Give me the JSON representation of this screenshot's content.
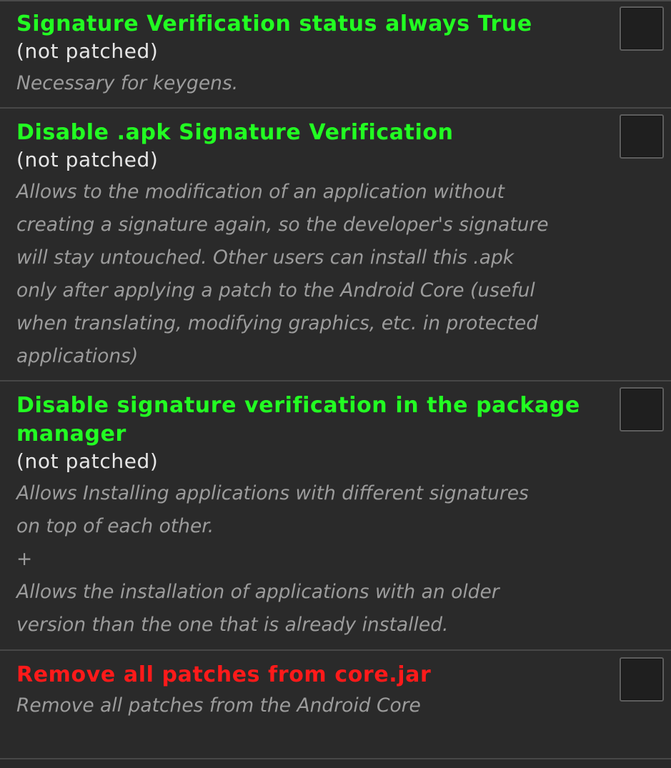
{
  "colors": {
    "background": "#2a2a2a",
    "title_green": "#22ff22",
    "title_red": "#ff1a1a",
    "status_text": "#e6e6e6",
    "description_text": "#9c9c9c",
    "divider": "#474747"
  },
  "patches": [
    {
      "title": "Signature Verification status always True",
      "status": "(not patched)",
      "description": "Necessary for keygens.",
      "checked": false
    },
    {
      "title": "Disable .apk Signature Verification",
      "status": "(not patched)",
      "description": "Allows to the modification of an application without\ncreating a signature again, so the developer's signature\nwill stay untouched. Other users can install this .apk\nonly after applying a patch to the Android Core (useful\nwhen translating, modifying graphics, etc. in protected\napplications)",
      "checked": false
    },
    {
      "title": "Disable signature verification in the package manager",
      "status": "(not patched)",
      "description": "Allows Installing applications with different signatures\non top of each other.\n+\nAllows the installation of applications with an older\nversion than the one that is already installed.",
      "checked": false
    },
    {
      "title": "Remove all patches from core.jar",
      "description": "Remove all patches from the Android Core",
      "checked": false
    }
  ]
}
